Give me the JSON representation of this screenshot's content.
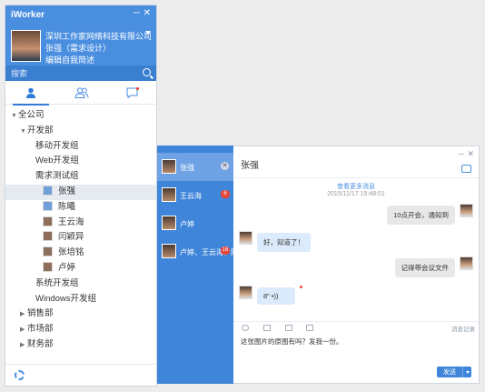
{
  "app": {
    "title": "iWorker",
    "min_btn": "─",
    "close_btn": "✕"
  },
  "profile": {
    "company": "深圳工作家网络科技有限公司",
    "name": "张强（需求设计）",
    "signature": "编辑自我简述"
  },
  "search": {
    "placeholder": "搜索"
  },
  "tabs": [
    {
      "icon": "contacts-icon"
    },
    {
      "icon": "groups-icon"
    },
    {
      "icon": "messages-icon"
    }
  ],
  "tree": {
    "root": "全公司",
    "dept_dev": "开发部",
    "group_mobile": "移动开发组",
    "group_web": "Web开发组",
    "group_req": "需求测试组",
    "members": [
      "张强",
      "陈曦",
      "王云海",
      "闫颖异",
      "张培铭",
      "卢婷"
    ],
    "group_sys": "系统开发组",
    "group_win": "Windows开发组",
    "dept_sales": "销售部",
    "dept_market": "市场部",
    "dept_finance": "财务部"
  },
  "chats": [
    {
      "name": "张强",
      "close": "✕"
    },
    {
      "name": "王云海",
      "badge": "6"
    },
    {
      "name": "卢婷"
    },
    {
      "name": "卢婷、王云海、陈...",
      "badge": "16"
    }
  ],
  "chat": {
    "title": "张强",
    "min_btn": "─",
    "close_btn": "✕",
    "history_link": "查看更多消息",
    "timestamp": "2015/11/17  15:48:01",
    "messages": [
      {
        "dir": "out",
        "text": "10点开会，通知到"
      },
      {
        "dir": "in",
        "text": "好，知道了！"
      },
      {
        "dir": "out",
        "text": "记得带会议文件"
      },
      {
        "dir": "in",
        "text": "8\"  •))"
      }
    ],
    "record_link": "消息记录",
    "draft": "这张图片的原图有吗？发我一份。",
    "send_label": "发送"
  },
  "colors": {
    "accent": "#4a8ee0",
    "chatlist_bg": "#3f85d9",
    "badge": "#e8473c"
  }
}
